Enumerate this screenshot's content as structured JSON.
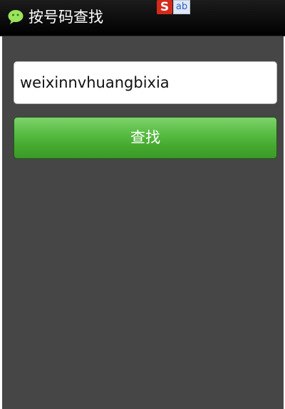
{
  "titlebar": {
    "title": "按号码查找",
    "app_icon": "chat-bubble-icon",
    "ime_indicator": {
      "logo_letter": "S",
      "mode": "ab"
    }
  },
  "search": {
    "value": "weixinnvhuangbixia"
  },
  "find_button": {
    "label": "查找"
  },
  "colors": {
    "titlebar": "#000000",
    "content_background": "#464646",
    "button_green": "#45a92f",
    "icon_green": "#9be35c"
  }
}
